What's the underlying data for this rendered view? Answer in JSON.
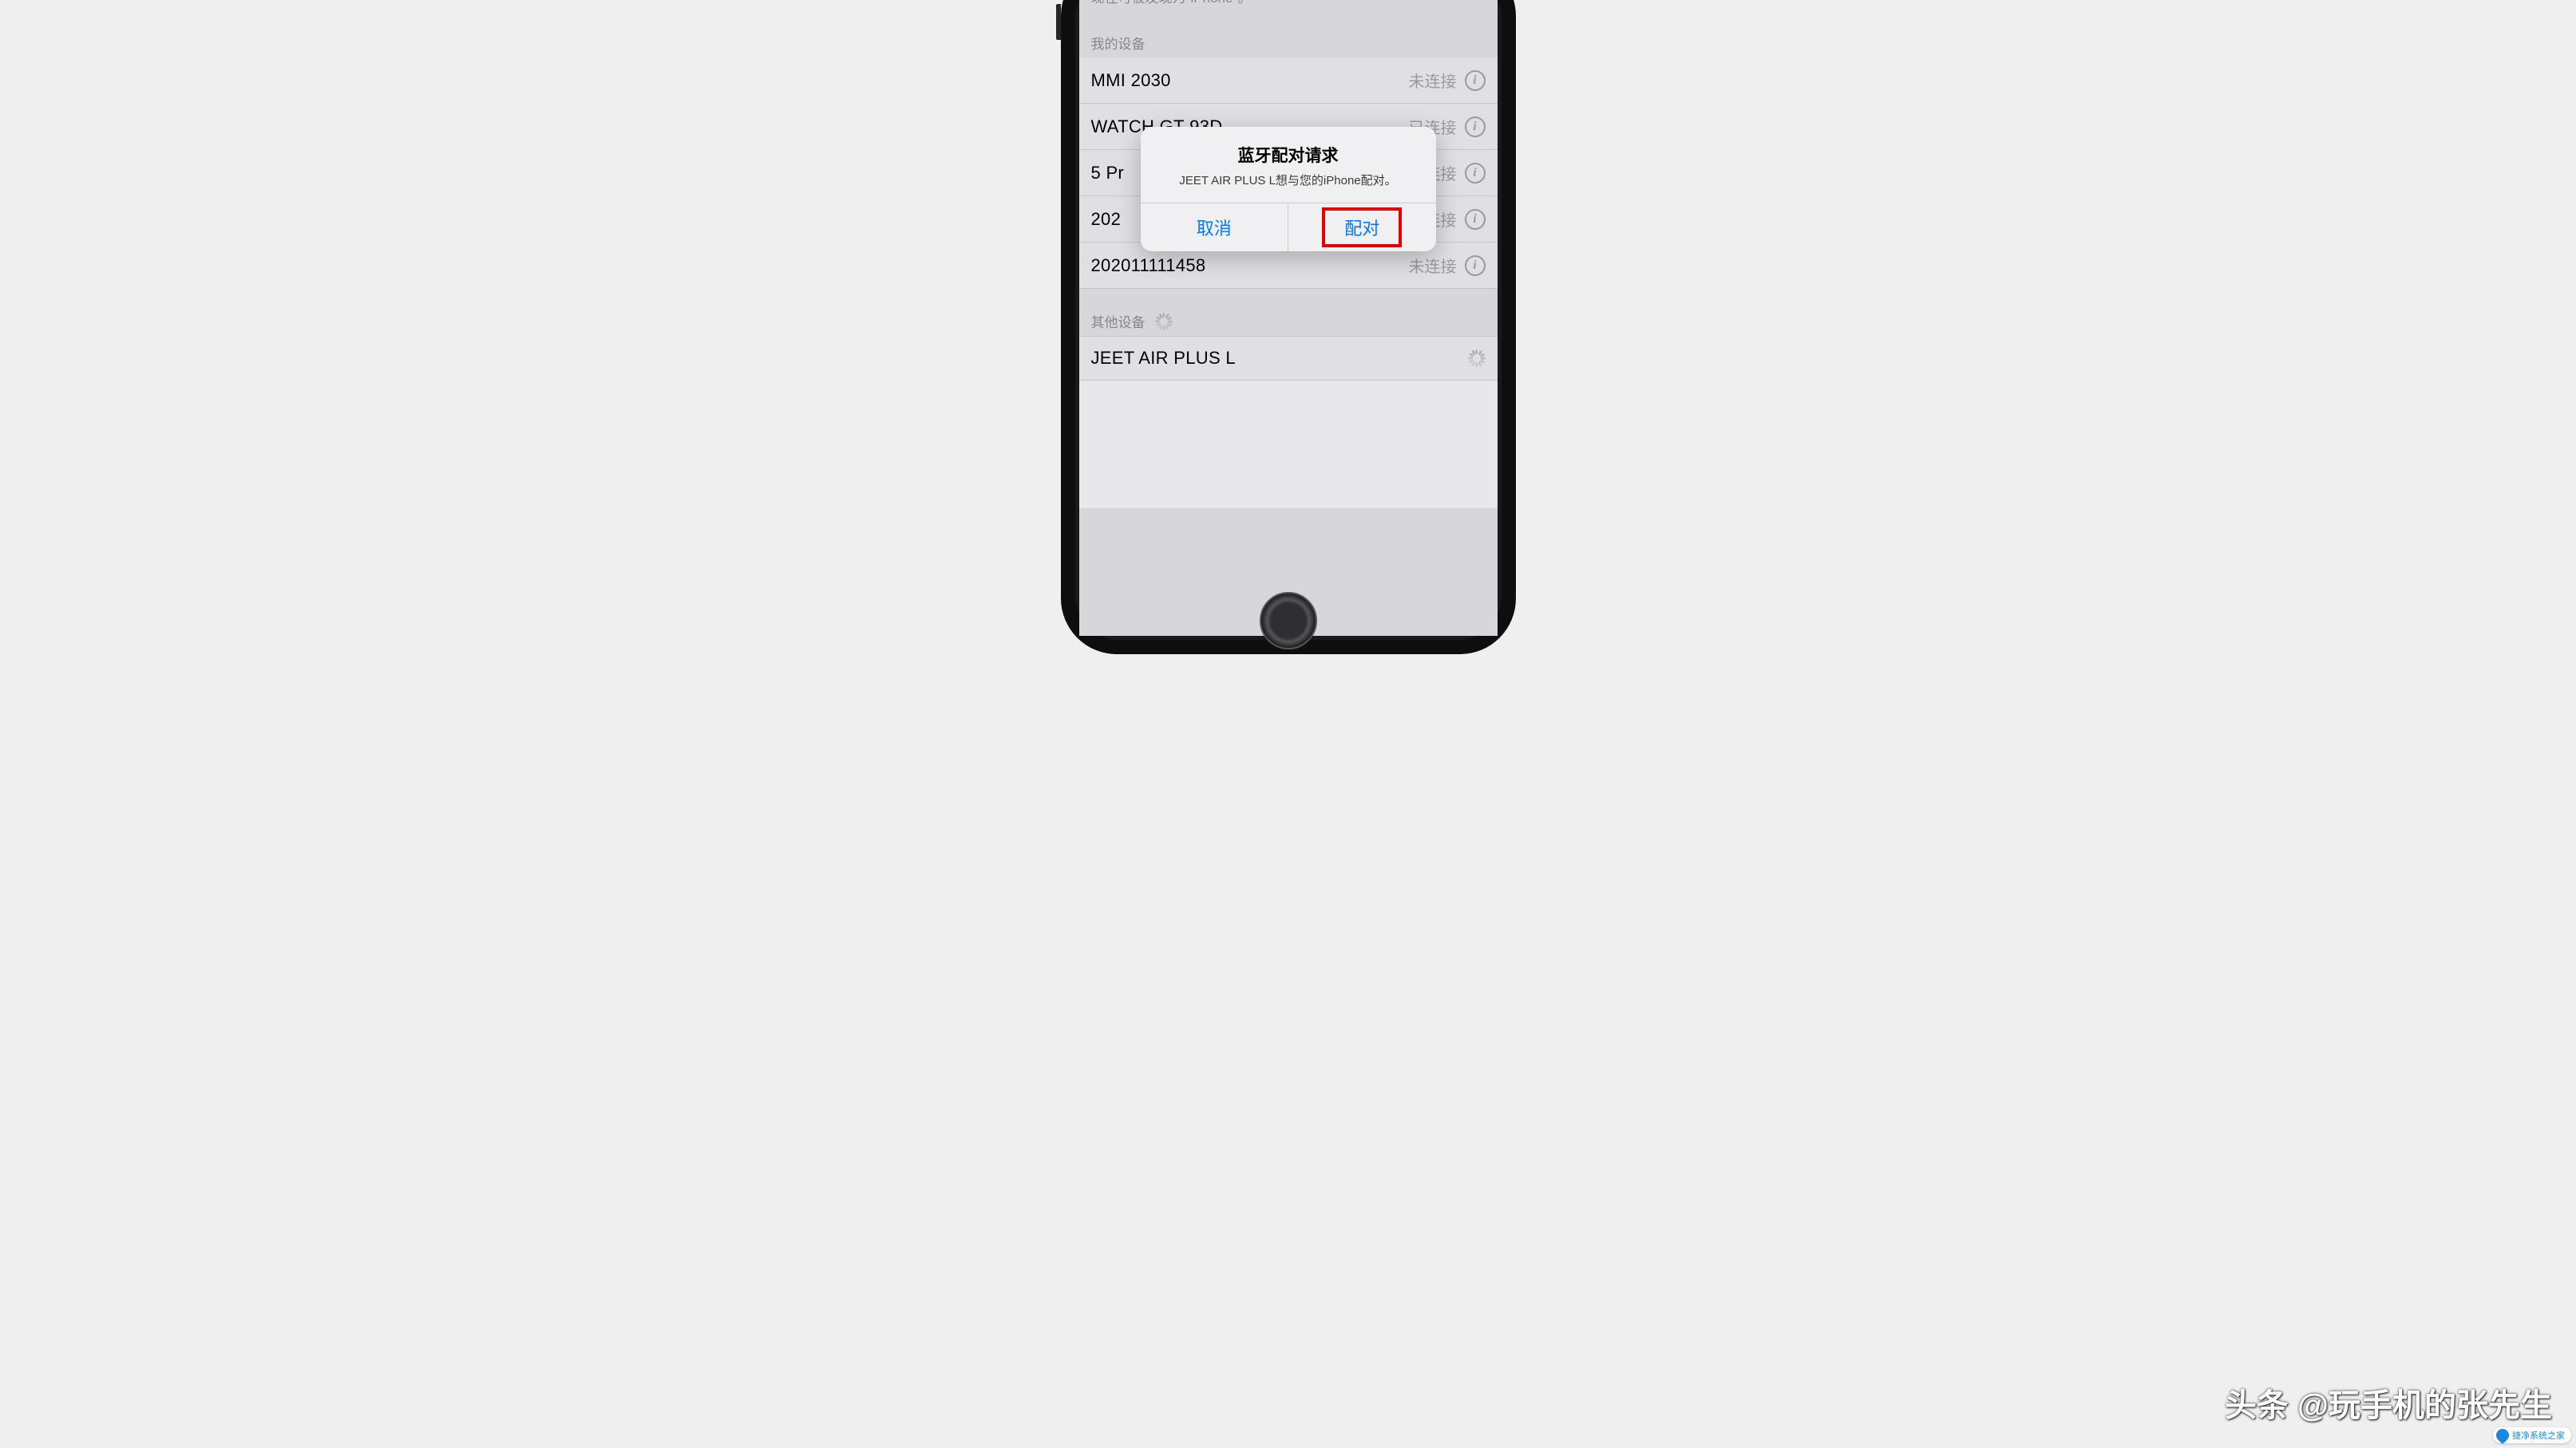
{
  "status_text": "现在可被发现为\"iPhone\"。",
  "sections": {
    "my_devices_label": "我的设备",
    "other_devices_label": "其他设备"
  },
  "my_devices": [
    {
      "name": "MMI 2030",
      "status": "未连接"
    },
    {
      "name": "WATCH GT-93D",
      "status": "已连接"
    },
    {
      "name": "5 Pr",
      "status": "未连接"
    },
    {
      "name": "202",
      "status": "未连接"
    },
    {
      "name": "202011111458",
      "status": "未连接"
    }
  ],
  "other_devices": [
    {
      "name": "JEET AIR PLUS L"
    }
  ],
  "alert": {
    "title": "蓝牙配对请求",
    "message": "JEET AIR PLUS L想与您的iPhone配对。",
    "cancel": "取消",
    "confirm": "配对"
  },
  "watermark": {
    "text": "头条 @玩手机的张先生",
    "badge": "捷净系统之家"
  }
}
